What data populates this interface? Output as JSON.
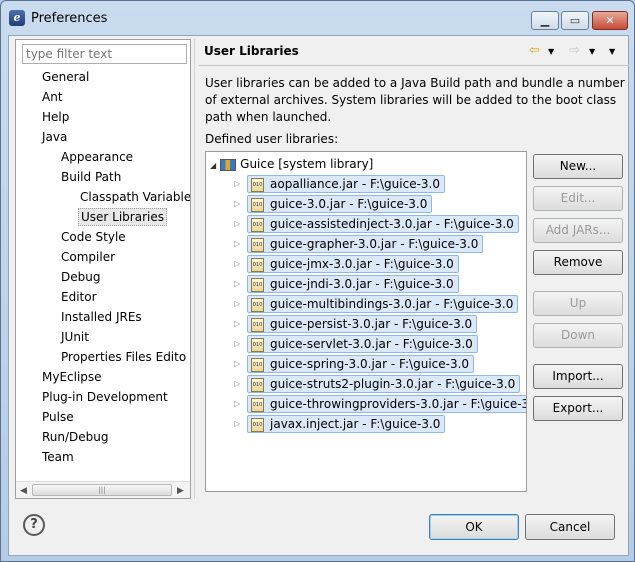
{
  "window": {
    "title": "Preferences",
    "app_icon": "eclipse-icon",
    "controls": [
      "minimize-icon",
      "maximize-icon",
      "close-icon"
    ]
  },
  "sidebar": {
    "filter_placeholder": "type filter text",
    "items": [
      {
        "label": "General",
        "level": 1
      },
      {
        "label": "Ant",
        "level": 1
      },
      {
        "label": "Help",
        "level": 1
      },
      {
        "label": "Java",
        "level": 1
      },
      {
        "label": "Appearance",
        "level": 2
      },
      {
        "label": "Build Path",
        "level": 2
      },
      {
        "label": "Classpath Variable",
        "level": 3
      },
      {
        "label": "User Libraries",
        "level": 3,
        "selected": true
      },
      {
        "label": "Code Style",
        "level": 2
      },
      {
        "label": "Compiler",
        "level": 2
      },
      {
        "label": "Debug",
        "level": 2
      },
      {
        "label": "Editor",
        "level": 2
      },
      {
        "label": "Installed JREs",
        "level": 2
      },
      {
        "label": "JUnit",
        "level": 2
      },
      {
        "label": "Properties Files Edito",
        "level": 2
      },
      {
        "label": "MyEclipse",
        "level": 1
      },
      {
        "label": "Plug-in Development",
        "level": 1
      },
      {
        "label": "Pulse",
        "level": 1
      },
      {
        "label": "Run/Debug",
        "level": 1
      },
      {
        "label": "Team",
        "level": 1
      }
    ]
  },
  "page": {
    "title": "User Libraries",
    "description": "User libraries can be added to a Java Build path and bundle a number of external archives. System libraries will be added to the boot class path when launched.",
    "defined_label": "Defined user libraries:",
    "library": {
      "name": "Guice [system library]",
      "jars": [
        "aopalliance.jar - F:\\guice-3.0",
        "guice-3.0.jar - F:\\guice-3.0",
        "guice-assistedinject-3.0.jar - F:\\guice-3.0",
        "guice-grapher-3.0.jar - F:\\guice-3.0",
        "guice-jmx-3.0.jar - F:\\guice-3.0",
        "guice-jndi-3.0.jar - F:\\guice-3.0",
        "guice-multibindings-3.0.jar - F:\\guice-3.0",
        "guice-persist-3.0.jar - F:\\guice-3.0",
        "guice-servlet-3.0.jar - F:\\guice-3.0",
        "guice-spring-3.0.jar - F:\\guice-3.0",
        "guice-struts2-plugin-3.0.jar - F:\\guice-3.0",
        "guice-throwingproviders-3.0.jar - F:\\guice-3.",
        "javax.inject.jar - F:\\guice-3.0"
      ]
    }
  },
  "buttons": {
    "new": "New...",
    "edit": "Edit...",
    "add_jars": "Add JARs...",
    "remove": "Remove",
    "up": "Up",
    "down": "Down",
    "import": "Import...",
    "export": "Export...",
    "ok": "OK",
    "cancel": "Cancel"
  },
  "jar_icon_text": "010",
  "help_glyph": "?"
}
